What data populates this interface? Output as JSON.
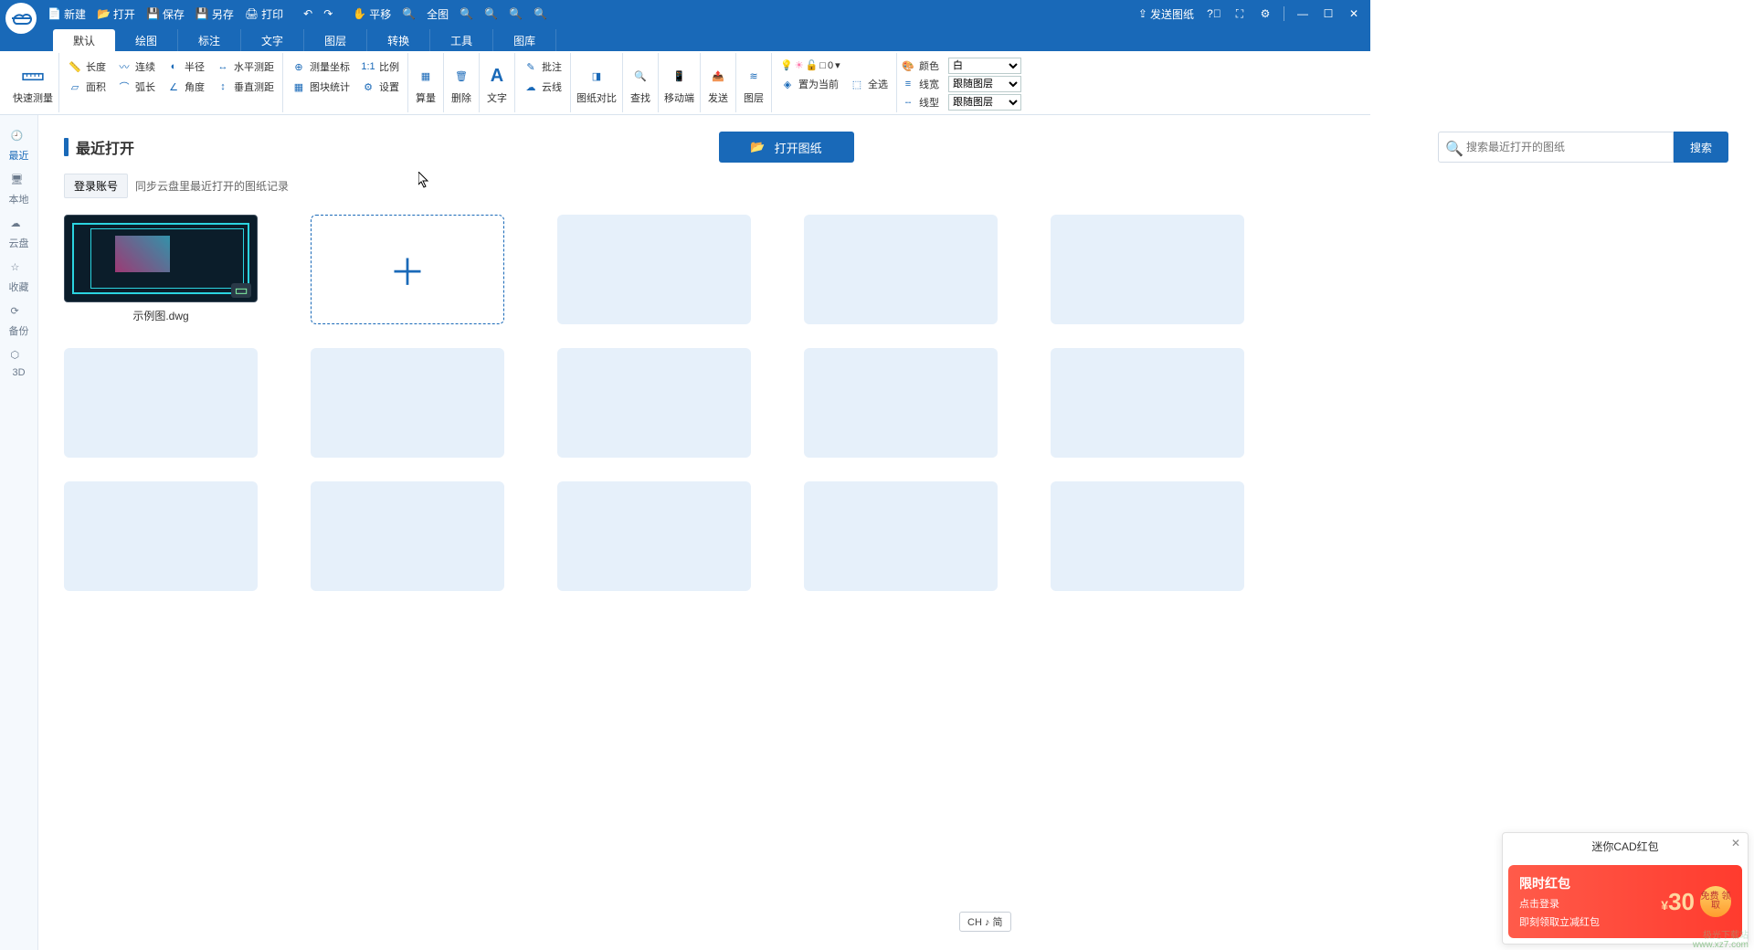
{
  "titlebar": {
    "new": "新建",
    "open": "打开",
    "save": "保存",
    "saveas": "另存",
    "print": "打印",
    "pan": "平移",
    "fullview": "全图",
    "send": "发送图纸"
  },
  "tabs": [
    "默认",
    "绘图",
    "标注",
    "文字",
    "图层",
    "转换",
    "工具",
    "图库"
  ],
  "ribbon": {
    "quick_measure": "快速测量",
    "measure": {
      "length": "长度",
      "continuous": "连续",
      "radius": "半径",
      "hdist": "水平测距",
      "area": "面积",
      "arc": "弧长",
      "angle": "角度",
      "vdist": "垂直测距",
      "coord": "测量坐标",
      "ratio": "比例",
      "blockstat": "图块统计",
      "settings": "设置"
    },
    "calc": "算量",
    "delete": "删除",
    "text": "文字",
    "annotate": "批注",
    "cloud": "云线",
    "compare": "图纸对比",
    "find": "查找",
    "mobile": "移动端",
    "send": "发送",
    "layer": "图层",
    "setcurrent": "置为当前",
    "selectall": "全选",
    "props": {
      "color_lbl": "颜色",
      "color_val": "白",
      "lw_lbl": "线宽",
      "lw_val": "跟随图层",
      "lt_lbl": "线型",
      "lt_val": "跟随图层"
    },
    "lightbulbs_hint": ""
  },
  "sidebar": [
    {
      "id": "recent",
      "label": "最近"
    },
    {
      "id": "local",
      "label": "本地"
    },
    {
      "id": "cloud",
      "label": "云盘"
    },
    {
      "id": "fav",
      "label": "收藏"
    },
    {
      "id": "backup",
      "label": "备份"
    },
    {
      "id": "3d",
      "label": "3D"
    }
  ],
  "main": {
    "section_title": "最近打开",
    "open_btn": "打开图纸",
    "search_placeholder": "搜索最近打开的图纸",
    "search_btn": "搜索",
    "login_btn": "登录账号",
    "login_desc": "同步云盘里最近打开的图纸记录",
    "file1_name": "示例图.dwg"
  },
  "popup": {
    "title": "迷你CAD红包",
    "badge": "限时红包",
    "line1": "点击登录",
    "line2": "即刻领取立减红包",
    "currency": "¥",
    "amount": "30",
    "get": "免费\n领取"
  },
  "ime": "CH ♪ 简",
  "watermark_brand": "极光下载站",
  "watermark_url": "www.xz7.com"
}
